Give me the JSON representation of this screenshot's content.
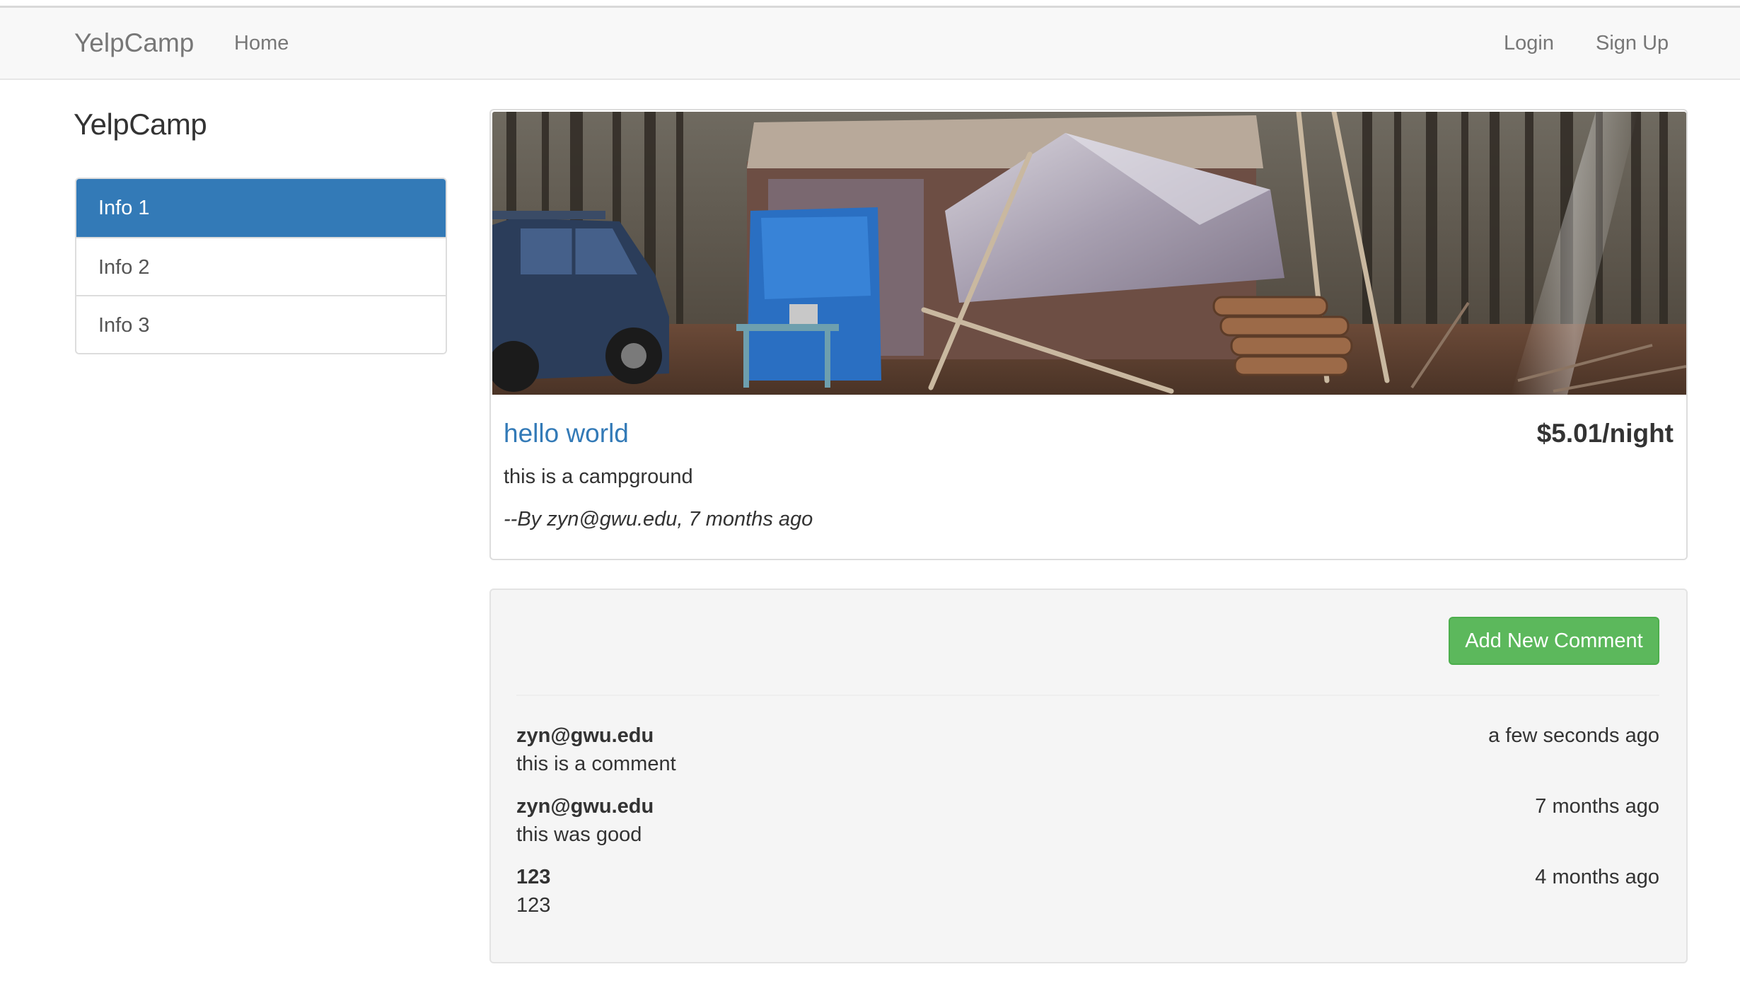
{
  "navbar": {
    "brand": "YelpCamp",
    "home_label": "Home",
    "login_label": "Login",
    "signup_label": "Sign Up"
  },
  "sidebar": {
    "title": "YelpCamp",
    "items": [
      {
        "label": "Info 1",
        "active": true
      },
      {
        "label": "Info 2",
        "active": false
      },
      {
        "label": "Info 3",
        "active": false
      }
    ],
    "active_color": "#337ab7"
  },
  "campground": {
    "name": "hello world",
    "price": "$5.01/night",
    "description": "this is a campground",
    "author_line": "--By zyn@gwu.edu, 7 months ago",
    "link_color": "#337ab7"
  },
  "comments": {
    "add_button_label": "Add New Comment",
    "add_button_color": "#5cb85c",
    "items": [
      {
        "author": "zyn@gwu.edu",
        "time": "a few seconds ago",
        "text": "this is a comment"
      },
      {
        "author": "zyn@gwu.edu",
        "time": "7 months ago",
        "text": "this was good"
      },
      {
        "author": "123",
        "time": "4 months ago",
        "text": "123"
      }
    ]
  }
}
